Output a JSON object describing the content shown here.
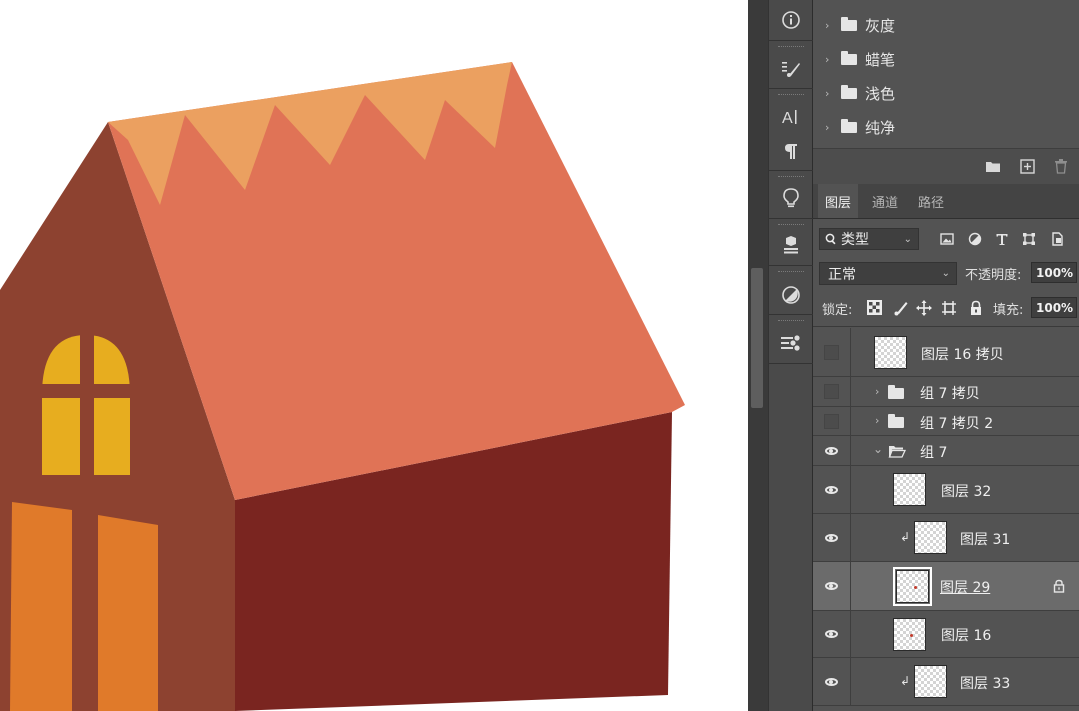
{
  "canvas": {
    "colors": {
      "background": "#ffffff",
      "roof_main": "#e07356",
      "roof_fringe": "#eba060",
      "front_wall": "#8d4230",
      "side_wall": "#7a2520",
      "window_upper": "#e7ad1f",
      "window_lower": "#e07a2a"
    }
  },
  "tool_strip": {
    "items": [
      {
        "icon": "info-icon",
        "glyph": "ⓘ"
      },
      {
        "icon": "brush-settings-icon",
        "glyph": "⁝⁄"
      },
      {
        "icon": "character-icon",
        "glyph": "A|"
      },
      {
        "icon": "paragraph-icon",
        "glyph": "¶"
      },
      {
        "icon": "learn-bulb-icon",
        "glyph": "💡"
      },
      {
        "icon": "3d-icon",
        "glyph": "⧉"
      },
      {
        "icon": "adjustments-icon",
        "glyph": "◐"
      },
      {
        "icon": "properties-icon",
        "glyph": "☰"
      }
    ]
  },
  "swatch_groups": [
    {
      "label": "灰度"
    },
    {
      "label": "蜡笔"
    },
    {
      "label": "浅色"
    },
    {
      "label": "纯净"
    }
  ],
  "swatch_footer": {
    "icons": [
      "folder-icon",
      "new-swatch-icon",
      "trash-icon"
    ]
  },
  "layers_panel": {
    "tabs": [
      {
        "label": "图层",
        "active": true
      },
      {
        "label": "通道",
        "active": false
      },
      {
        "label": "路径",
        "active": false
      }
    ],
    "filter": {
      "label": "类型",
      "icon": "search-icon"
    },
    "filter_icons": [
      "image-filter-icon",
      "adjustment-filter-icon",
      "type-filter-icon",
      "shape-filter-icon",
      "smart-object-filter-icon"
    ],
    "blend_mode": "正常",
    "opacity_label": "不透明度:",
    "opacity_value": "100%",
    "lock_label": "锁定:",
    "fill_label": "填充:",
    "fill_value": "100%",
    "layers": [
      {
        "name": "图层 16 拷贝",
        "visible": false,
        "type": "layer"
      },
      {
        "name": "组 7 拷贝",
        "visible": false,
        "type": "group",
        "expanded": false
      },
      {
        "name": "组 7 拷贝 2",
        "visible": false,
        "type": "group",
        "expanded": false
      },
      {
        "name": "组 7",
        "visible": true,
        "type": "group",
        "expanded": true
      },
      {
        "name": "图层 32",
        "visible": true,
        "type": "layer"
      },
      {
        "name": "图层 31",
        "visible": true,
        "type": "layer",
        "clipped": true
      },
      {
        "name": "图层 29",
        "visible": true,
        "type": "layer",
        "selected": true,
        "locked": true
      },
      {
        "name": "图层 16",
        "visible": true,
        "type": "layer"
      },
      {
        "name": "图层 33",
        "visible": true,
        "type": "layer",
        "clipped": true
      }
    ]
  }
}
